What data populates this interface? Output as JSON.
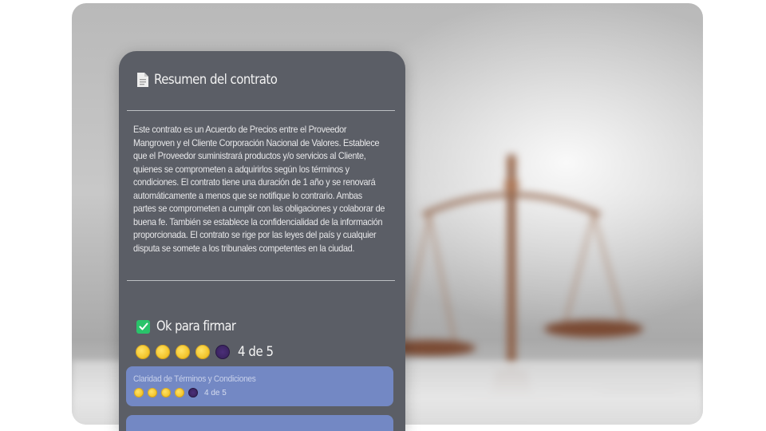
{
  "card": {
    "title": "Resumen del contrato",
    "summary": "Este contrato es un Acuerdo de Precios entre el Proveedor Mangroven y el Cliente Corporación Nacional de Valores. Establece que el Proveedor suministrará productos y/o servicios al Cliente, quienes se comprometen a adquirirlos según los términos y condiciones. El contrato tiene una duración de 1 año y se renovará automáticamente a menos que se notifique lo contrario. Ambas partes se comprometen a cumplir con las obligaciones y colaborar de buena fe. También se establece la confidencialidad de la información proporcionada. El contrato se rige por las leyes del país y cualquier disputa se somete a los tribunales competentes en la ciudad.",
    "status_label": "Ok para firmar",
    "rating": 4,
    "rating_max": 5,
    "rating_text": "4 de 5"
  },
  "criteria": [
    {
      "title": "Claridad de Términos y Condiciones",
      "rating": 4,
      "rating_max": 5,
      "rating_text": "4 de 5"
    }
  ],
  "icons": {
    "header": "document-icon",
    "status": "checkbox-checked-icon",
    "rating_filled": "filled-circle-icon",
    "rating_empty": "empty-circle-icon"
  },
  "colors": {
    "card_background": "#5b5e66",
    "criterion_background": "#7388c4",
    "check_green": "#29c36a",
    "rating_filled": "#f3c52c",
    "rating_empty": "#39235f"
  }
}
